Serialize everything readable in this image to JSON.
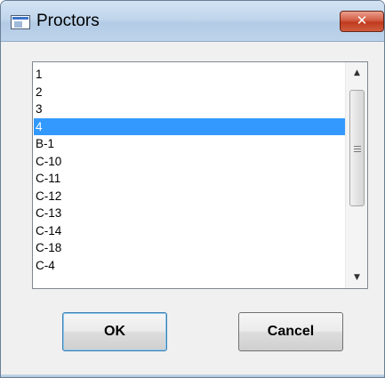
{
  "window": {
    "title": "Proctors",
    "close_label": "✕"
  },
  "list": {
    "items": [
      "1",
      "2",
      "3",
      "4",
      "B-1",
      "C-10",
      "C-11",
      "C-12",
      "C-13",
      "C-14",
      "C-18",
      "C-4"
    ],
    "selected_value": "4"
  },
  "scrollbar": {
    "up_arrow": "▲",
    "down_arrow": "▼"
  },
  "buttons": {
    "ok_label": "OK",
    "cancel_label": "Cancel"
  },
  "colors": {
    "selection": "#3399ff",
    "title_bar": "#c1d6ec",
    "close_button": "#c03a1e"
  }
}
